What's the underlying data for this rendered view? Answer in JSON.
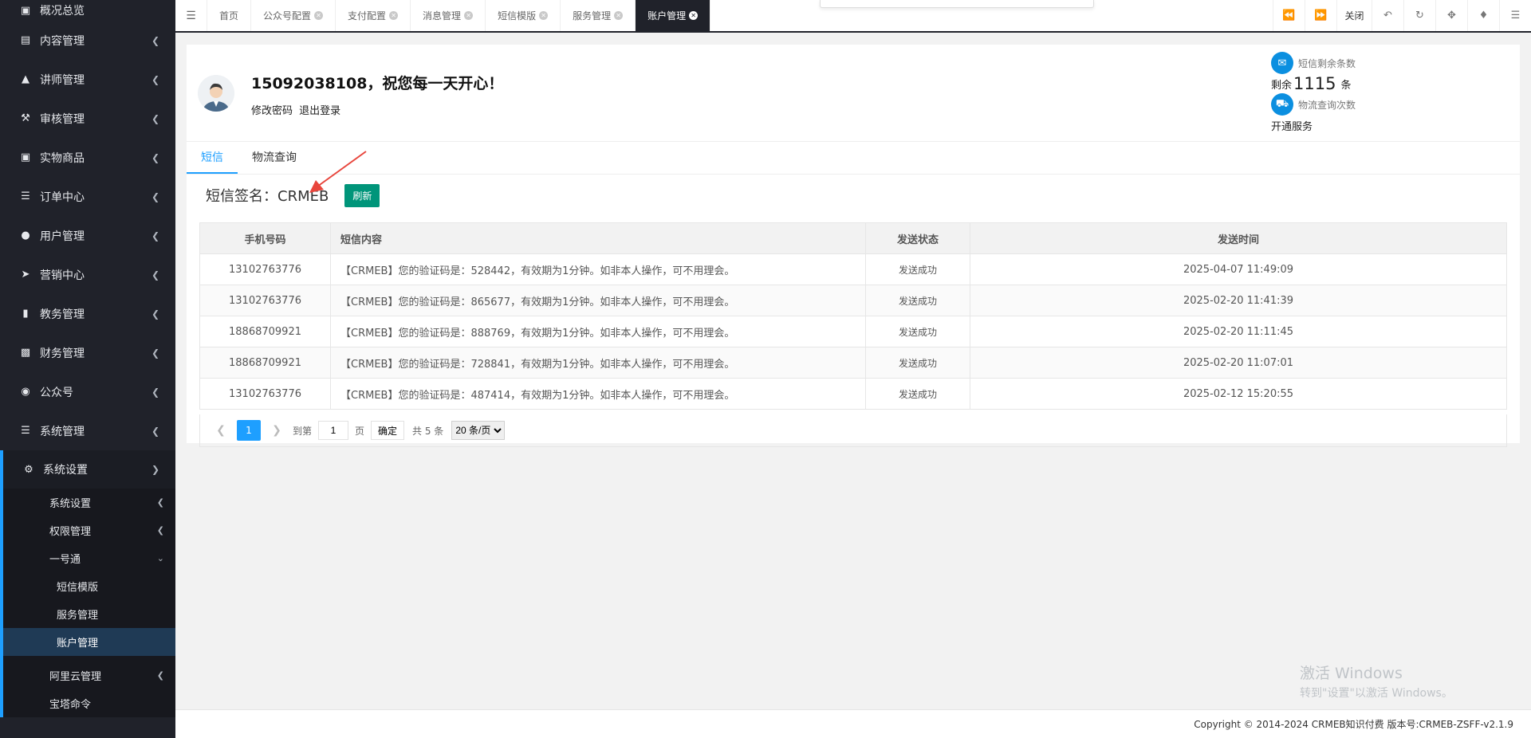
{
  "sidebar": {
    "items": [
      {
        "label": "概况总览",
        "icon": "bank-icon"
      },
      {
        "label": "内容管理",
        "icon": "newspaper-icon"
      },
      {
        "label": "讲师管理",
        "icon": "graduation-cap-icon"
      },
      {
        "label": "审核管理",
        "icon": "gavel-icon"
      },
      {
        "label": "实物商品",
        "icon": "cart-icon"
      },
      {
        "label": "订单中心",
        "icon": "list-icon"
      },
      {
        "label": "用户管理",
        "icon": "user-icon"
      },
      {
        "label": "营销中心",
        "icon": "paper-plane-icon"
      },
      {
        "label": "教务管理",
        "icon": "book-icon"
      },
      {
        "label": "财务管理",
        "icon": "money-icon"
      },
      {
        "label": "公众号",
        "icon": "wechat-icon"
      },
      {
        "label": "系统管理",
        "icon": "list-icon"
      }
    ],
    "open_section": {
      "label": "系统设置",
      "icon": "gear-icon"
    },
    "sub_items": [
      {
        "label": "系统设置"
      },
      {
        "label": "权限管理"
      },
      {
        "label": "一号通"
      }
    ],
    "sub2_items": [
      {
        "label": "短信模版"
      },
      {
        "label": "服务管理"
      },
      {
        "label": "账户管理"
      }
    ],
    "more_items": [
      {
        "label": "阿里云管理"
      },
      {
        "label": "宝塔命令"
      }
    ]
  },
  "tabs": [
    {
      "label": "首页"
    },
    {
      "label": "公众号配置"
    },
    {
      "label": "支付配置"
    },
    {
      "label": "消息管理"
    },
    {
      "label": "短信模版"
    },
    {
      "label": "服务管理"
    },
    {
      "label": "账户管理"
    }
  ],
  "topbar": {
    "close_label": "关闭"
  },
  "account": {
    "greeting": "15092038108，祝您每一天开心！",
    "change_password": "修改密码",
    "logout": "退出登录"
  },
  "stats": {
    "sms_label": "短信剩余条数",
    "remaining_prefix": "剩余",
    "remaining_count": "1115",
    "remaining_unit": "条",
    "logistics_label": "物流查询次数",
    "open_service": "开通服务"
  },
  "content_tabs": [
    {
      "label": "短信"
    },
    {
      "label": "物流查询"
    }
  ],
  "signature": {
    "label": "短信签名：CRMEB",
    "refresh": "刷新"
  },
  "table": {
    "headers": [
      "手机号码",
      "短信内容",
      "发送状态",
      "发送时间"
    ],
    "rows": [
      {
        "phone": "13102763776",
        "content": "【CRMEB】您的验证码是：528442，有效期为1分钟。如非本人操作，可不用理会。",
        "status": "发送成功",
        "time": "2025-04-07 11:49:09"
      },
      {
        "phone": "13102763776",
        "content": "【CRMEB】您的验证码是：865677，有效期为1分钟。如非本人操作，可不用理会。",
        "status": "发送成功",
        "time": "2025-02-20 11:41:39"
      },
      {
        "phone": "18868709921",
        "content": "【CRMEB】您的验证码是：888769，有效期为1分钟。如非本人操作，可不用理会。",
        "status": "发送成功",
        "time": "2025-02-20 11:11:45"
      },
      {
        "phone": "18868709921",
        "content": "【CRMEB】您的验证码是：728841，有效期为1分钟。如非本人操作，可不用理会。",
        "status": "发送成功",
        "time": "2025-02-20 11:07:01"
      },
      {
        "phone": "13102763776",
        "content": "【CRMEB】您的验证码是：487414，有效期为1分钟。如非本人操作，可不用理会。",
        "status": "发送成功",
        "time": "2025-02-12 15:20:55"
      }
    ]
  },
  "pagination": {
    "current": "1",
    "goto_label": "到第",
    "goto_value": "1",
    "page_unit": "页",
    "confirm": "确定",
    "total": "共 5 条",
    "page_size": "20 条/页"
  },
  "watermark": {
    "line1": "激活 Windows",
    "line2": "转到\"设置\"以激活 Windows。"
  },
  "footer": {
    "copyright": "Copyright © 2014-2024 CRMEB知识付费 版本号:CRMEB-ZSFF-v2.1.9"
  },
  "colors": {
    "sidebar_bg": "#20222a",
    "accent": "#1e9fff",
    "refresh_green": "#00957a",
    "stat_icon_blue": "#0b8fe0"
  }
}
